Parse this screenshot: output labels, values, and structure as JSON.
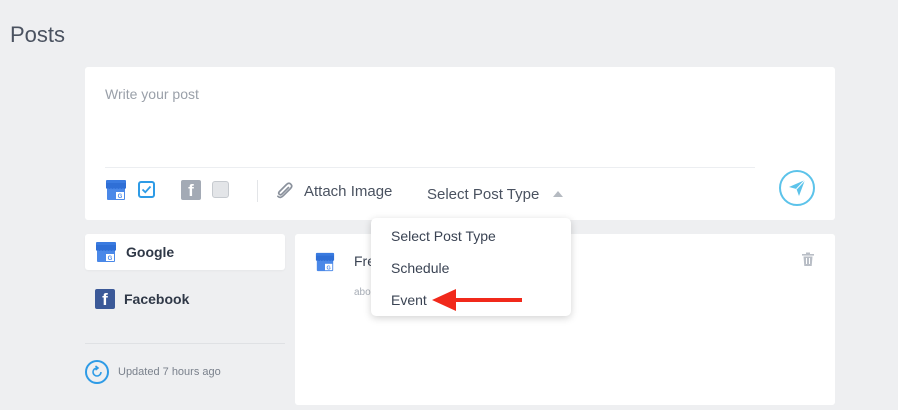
{
  "page": {
    "title": "Posts"
  },
  "composer": {
    "placeholder": "Write your post",
    "google_checkbox_checked": true,
    "facebook_checkbox_checked": false,
    "attach_label": "Attach Image",
    "post_type_label": "Select Post Type"
  },
  "dropdown": {
    "items": [
      "Select Post Type",
      "Schedule",
      "Event"
    ]
  },
  "sidebar": {
    "items": [
      {
        "label": "Google",
        "icon": "google-my-business-icon",
        "active": true
      },
      {
        "label": "Facebook",
        "icon": "facebook-icon",
        "active": false
      }
    ],
    "updated": "Updated 7 hours ago"
  },
  "post": {
    "title_fragment": "Fre",
    "subtitle_fragment": "abo"
  },
  "colors": {
    "accent": "#2e9be6",
    "send": "#5cc3ea",
    "annotation_arrow": "#f1291b",
    "background": "#eeeff1"
  }
}
